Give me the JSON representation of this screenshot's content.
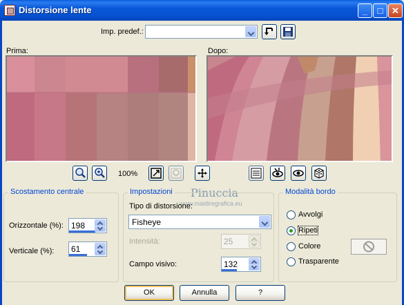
{
  "window": {
    "title": "Distorsione lente"
  },
  "colors": {
    "accent": "#0046d5",
    "titlebar": "#0a5fdd"
  },
  "preset": {
    "label": "Imp. predef.:",
    "value": ""
  },
  "previews": {
    "before_label": "Prima:",
    "after_label": "Dopo:"
  },
  "zoom": {
    "level": "100%"
  },
  "watermark": {
    "line1": "Pinuccia",
    "line2": "www.maidiregrafica.eu"
  },
  "center_offset": {
    "title": "Scostamento centrale",
    "horizontal_label": "Orizzontale (%):",
    "horizontal_value": "198",
    "vertical_label": "Verticale (%):",
    "vertical_value": "61"
  },
  "settings": {
    "title": "Impostazioni",
    "distortion_type_label": "Tipo di distorsione:",
    "distortion_type_value": "Fisheye",
    "intensity_label": "Intensità:",
    "intensity_value": "25",
    "field_of_view_label": "Campo visivo:",
    "field_of_view_value": "132"
  },
  "edge_mode": {
    "title": "Modalità bordo",
    "options": [
      "Avvolgi",
      "Ripeti",
      "Colore",
      "Trasparente"
    ],
    "selected": "Ripeti"
  },
  "buttons": {
    "ok": "OK",
    "cancel": "Annulla",
    "help": "?"
  },
  "icons": [
    "window-icon",
    "minimize-icon",
    "maximize-icon",
    "close-icon",
    "load-preset-icon",
    "save-preset-icon",
    "zoom-in-icon",
    "zoom-out-icon",
    "fit-window-icon",
    "zoom-proof-icon",
    "pan-icon",
    "randomize-icon",
    "proof-icon",
    "reset-icon",
    "dice-icon",
    "no-color-icon"
  ]
}
